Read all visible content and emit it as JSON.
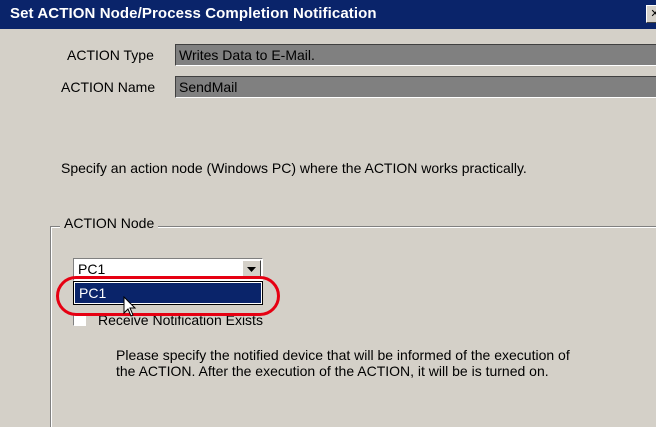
{
  "window": {
    "title": "Set ACTION Node/Process Completion Notification",
    "close_glyph": "✕"
  },
  "action_type": {
    "label": "ACTION Type",
    "value": "Writes Data to E-Mail."
  },
  "action_name": {
    "label": "ACTION Name",
    "value": "SendMail"
  },
  "instruction": "Specify an action node (Windows PC) where the ACTION works practically.",
  "action_node_group": {
    "legend": "ACTION Node",
    "combo_value": "PC1",
    "dropdown_items": [
      "PC1"
    ],
    "checkbox_label": "Receive Notification Exists",
    "checkbox_checked": false,
    "description": "Please specify the notified device that will be informed of the execution of the ACTION. After the execution of the ACTION, it will be is turned on."
  },
  "annotation": {
    "color": "#e60012"
  }
}
